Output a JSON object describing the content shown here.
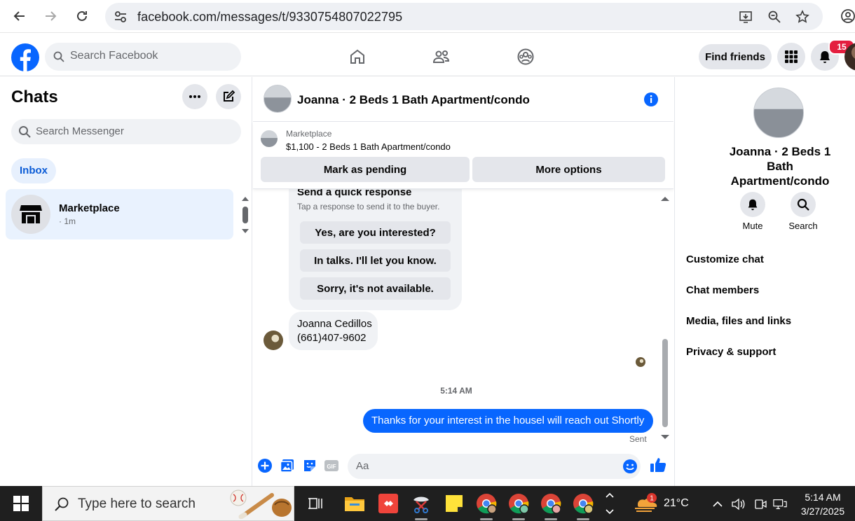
{
  "browser": {
    "url": "facebook.com/messages/t/9330754807022795"
  },
  "fb_header": {
    "search_placeholder": "Search Facebook",
    "find_friends": "Find friends",
    "notification_count": "15"
  },
  "sidebar": {
    "title": "Chats",
    "search_placeholder": "Search Messenger",
    "filter": "Inbox",
    "chats": [
      {
        "name": "Marketplace",
        "time": "· 1m"
      }
    ]
  },
  "conversation": {
    "title": "Joanna · 2 Beds 1 Bath Apartment/condo",
    "listing": {
      "label": "Marketplace",
      "price_title": "$1,100 - 2 Beds 1 Bath Apartment/condo",
      "mark_pending": "Mark as pending",
      "more_options": "More options"
    },
    "quick_response": {
      "title": "Send a quick response",
      "subtitle": "Tap a response to send it to the buyer.",
      "options": [
        "Yes, are you interested?",
        "In talks. I'll let you know.",
        "Sorry, it's not available."
      ]
    },
    "contact": {
      "name": "Joanna Cedillos",
      "phone": "(661)407-9602"
    },
    "timestamp": "5:14 AM",
    "outgoing": "Thanks for your interest in the housel will reach out Shortly",
    "sent_label": "Sent",
    "composer_placeholder": "Aa"
  },
  "right_panel": {
    "name": "Joanna · 2 Beds 1 Bath Apartment/condo",
    "mute": "Mute",
    "search": "Search",
    "menu": [
      "Customize chat",
      "Chat members",
      "Media, files and links",
      "Privacy & support"
    ]
  },
  "taskbar": {
    "search_placeholder": "Type here to search",
    "weather_badge": "1",
    "temperature": "21°C",
    "time": "5:14 AM",
    "date": "3/27/2025"
  },
  "colors": {
    "fb_blue": "#0866ff",
    "badge_red": "#e41e3f"
  }
}
